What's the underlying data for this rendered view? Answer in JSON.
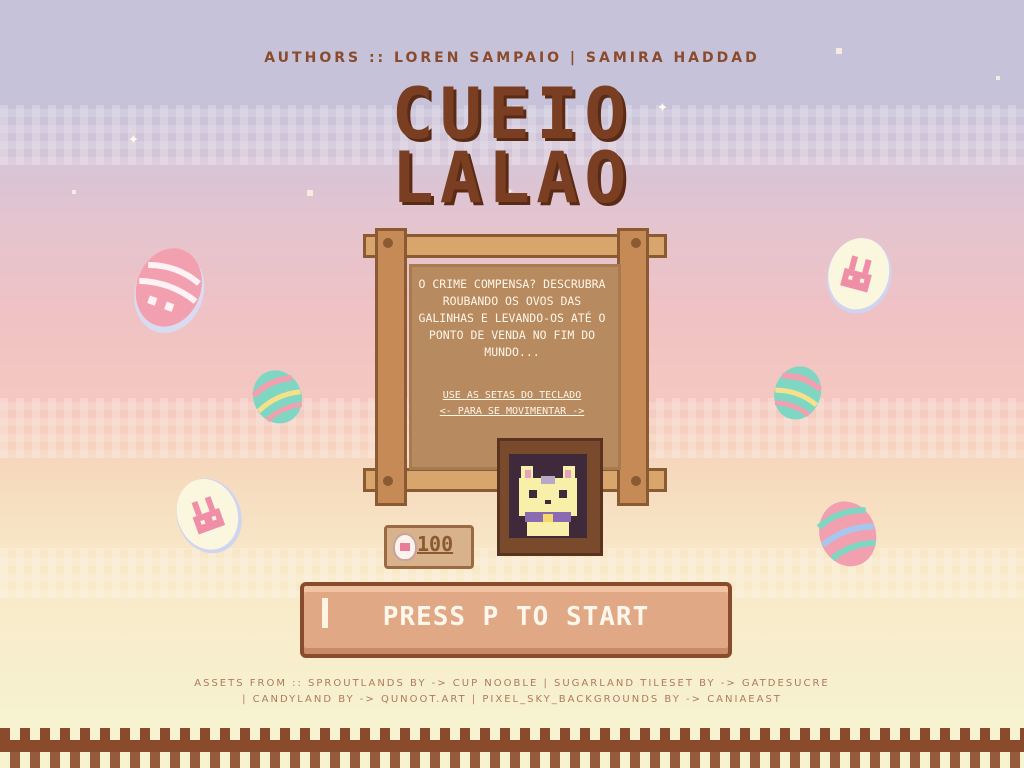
{
  "authors_line": "AUTHORS :: LOREN SAMPAIO | SAMIRA HADDAD",
  "title": {
    "line1": "CUEIO",
    "line2": "LALAO"
  },
  "board": {
    "description": "O CRIME COMPENSA? DESCRUBRA ROUBANDO OS OVOS DAS GALINHAS E LEVANDO-OS ATÉ O PONTO DE VENDA NO FIM DO MUNDO...",
    "hint_line1": "USE AS SETAS DO TECLADO",
    "hint_line2": "<- PARA SE MOVIMENTAR ->"
  },
  "counter": {
    "value": "100",
    "icon": "egg-coin-icon"
  },
  "start_button_label": "PRESS P TO START",
  "credits_line1": "ASSETS FROM :: SPROUTLANDS BY -> CUP NOOBLE | SUGARLAND TILESET BY -> GATDESUCRE",
  "credits_line2": "| CANDYLAND BY -> QUNOOT.ART | PIXEL_SKY_BACKGROUNDS BY -> CANIAEAST",
  "colors": {
    "title": "#7a3e22",
    "button": "#e0a885",
    "button_border": "#8a4a2c",
    "board": "#b88a5f",
    "egg_pink": "#f2a0b0",
    "egg_mint": "#7fd6c2"
  }
}
